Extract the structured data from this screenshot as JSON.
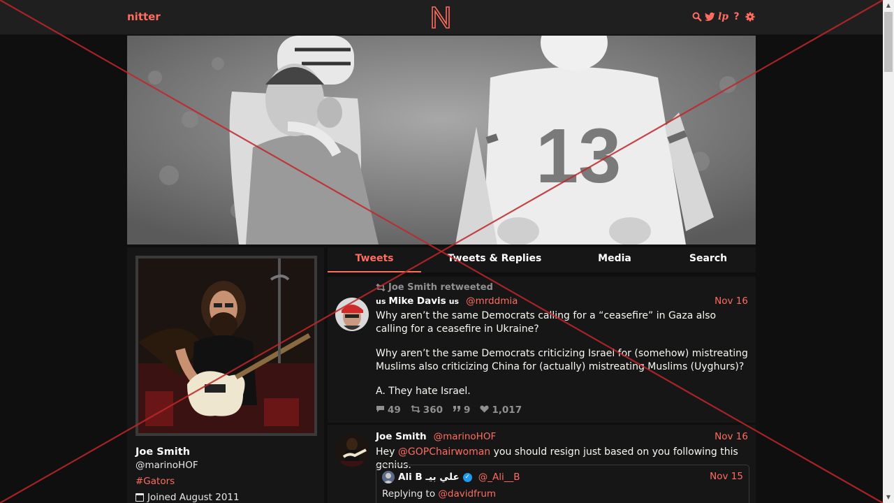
{
  "nav": {
    "brand": "nitter",
    "logo_letter": "N",
    "icons": [
      "search-icon",
      "twitter-bird-icon",
      "lp-icon",
      "help-icon",
      "settings-gear-icon"
    ],
    "lp_label": "lp",
    "help_label": "?"
  },
  "profile": {
    "fullname": "Joe Smith",
    "username": "@marinoHOF",
    "bio": "#Gators",
    "joined": "Joined August 2011"
  },
  "tabs": [
    {
      "label": "Tweets",
      "active": true
    },
    {
      "label": "Tweets & Replies",
      "active": false
    },
    {
      "label": "Media",
      "active": false
    },
    {
      "label": "Search",
      "active": false
    }
  ],
  "tweets": [
    {
      "retweet_by": "Joe Smith retweeted",
      "name_prefix_flag": "us",
      "name": "Mike Davis",
      "name_suffix_flag": "us",
      "handle": "@mrddmia",
      "date": "Nov 16",
      "paragraphs": [
        "Why aren’t the same Democrats calling for a “ceasefire” in Gaza also calling for a ceasefire in Ukraine?",
        "Why aren’t the same Democrats criticizing Israel for (somehow) mistreating Muslims also criticizing China for (actually) mistreating Muslims (Uyghurs)?",
        "A. They hate Israel."
      ],
      "stats": {
        "replies": "49",
        "retweets": "360",
        "quotes": "9",
        "likes": "1,017"
      }
    },
    {
      "name": "Joe Smith",
      "handle": "@marinoHOF",
      "date": "Nov 16",
      "text_before": "Hey ",
      "mention": "@GOPChairwoman",
      "text_after": " you should resign just based on you following this genius.",
      "quote": {
        "name": "Ali B علي بيـ",
        "handle": "@_Ali__B",
        "date": "Nov 15",
        "replying_label": "Replying to",
        "replying_to": "@davidfrum"
      }
    }
  ],
  "colors": {
    "accent": "#ff6c60",
    "background": "#0f0f0f",
    "panel": "#161616",
    "nav": "#1f1f1f"
  }
}
